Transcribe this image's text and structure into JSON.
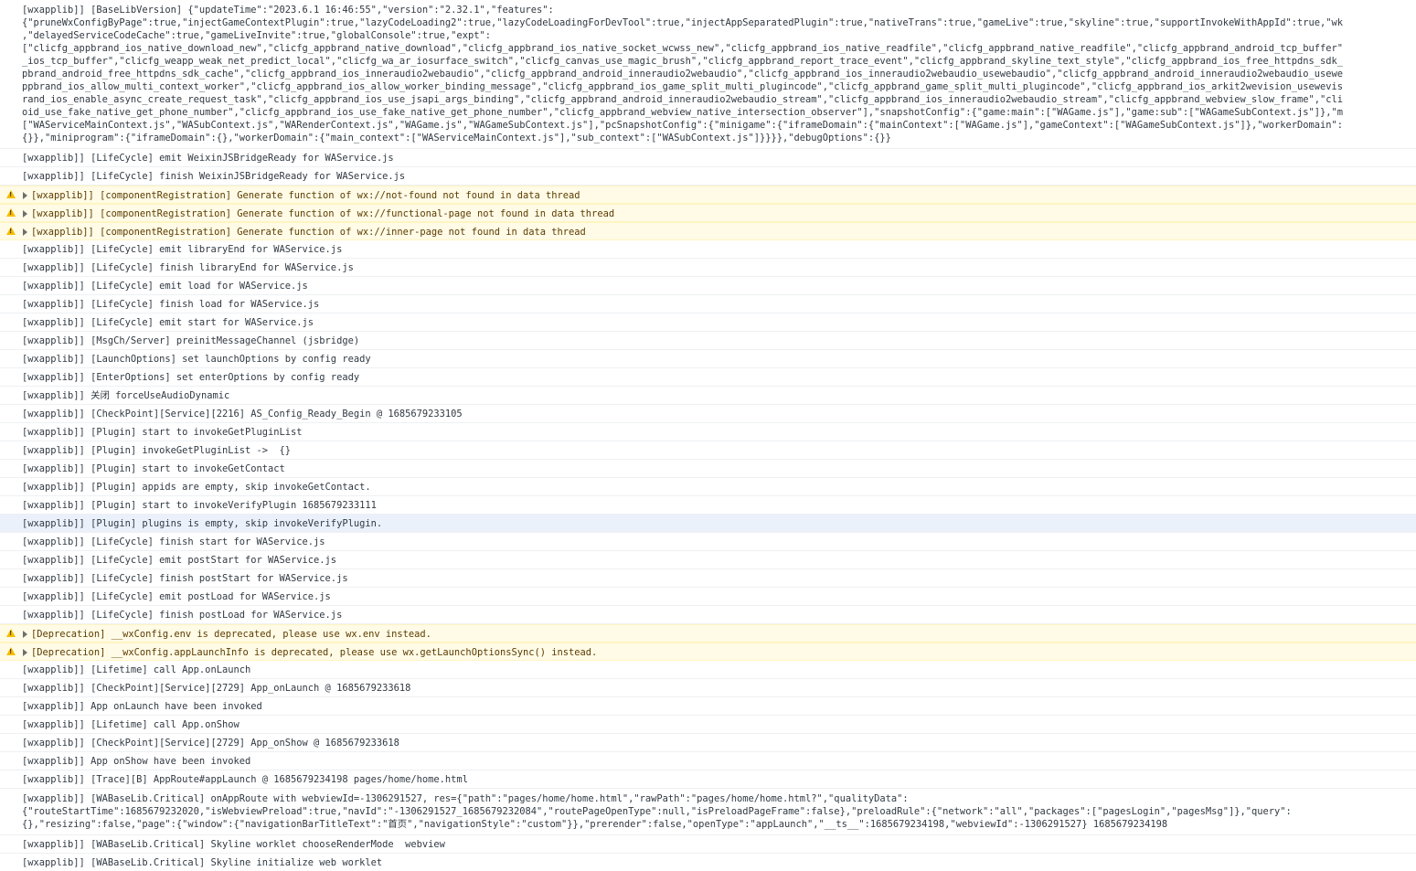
{
  "console": {
    "rows": [
      {
        "level": "log",
        "lines": [
          "[wxapplib]] [BaseLibVersion] {\"updateTime\":\"2023.6.1 16:46:55\",\"version\":\"2.32.1\",\"features\":",
          "{\"pruneWxConfigByPage\":true,\"injectGameContextPlugin\":true,\"lazyCodeLoading2\":true,\"lazyCodeLoadingForDevTool\":true,\"injectAppSeparatedPlugin\":true,\"nativeTrans\":true,\"gameLive\":true,\"skyline\":true,\"supportInvokeWithAppId\":true,\"wk",
          ",\"delayedServiceCodeCache\":true,\"gameLiveInvite\":true,\"globalConsole\":true,\"expt\":",
          "[\"clicfg_appbrand_ios_native_download_new\",\"clicfg_appbrand_native_download\",\"clicfg_appbrand_ios_native_socket_wcwss_new\",\"clicfg_appbrand_ios_native_readfile\",\"clicfg_appbrand_native_readfile\",\"clicfg_appbrand_android_tcp_buffer\"",
          "_ios_tcp_buffer\",\"clicfg_weapp_weak_net_predict_local\",\"clicfg_wa_ar_iosurface_switch\",\"clicfg_canvas_use_magic_brush\",\"clicfg_appbrand_report_trace_event\",\"clicfg_appbrand_skyline_text_style\",\"clicfg_appbrand_ios_free_httpdns_sdk_",
          "pbrand_android_free_httpdns_sdk_cache\",\"clicfg_appbrand_ios_inneraudio2webaudio\",\"clicfg_appbrand_android_inneraudio2webaudio\",\"clicfg_appbrand_ios_inneraudio2webaudio_usewebaudio\",\"clicfg_appbrand_android_inneraudio2webaudio_usewe",
          "ppbrand_ios_allow_multi_context_worker\",\"clicfg_appbrand_ios_allow_worker_binding_message\",\"clicfg_appbrand_ios_game_split_multi_plugincode\",\"clicfg_appbrand_game_split_multi_plugincode\",\"clicfg_appbrand_ios_arkit2wevision_usewevis",
          "rand_ios_enable_async_create_request_task\",\"clicfg_appbrand_ios_use_jsapi_args_binding\",\"clicfg_appbrand_android_inneraudio2webaudio_stream\",\"clicfg_appbrand_ios_inneraudio2webaudio_stream\",\"clicfg_appbrand_webview_slow_frame\",\"cli",
          "oid_use_fake_native_get_phone_number\",\"clicfg_appbrand_ios_use_fake_native_get_phone_number\",\"clicfg_appbrand_webview_native_intersection_observer\"],\"snapshotConfig\":{\"game:main\":[\"WAGame.js\"],\"game:sub\":[\"WAGameSubContext.js\"]},\"m",
          "[\"WAServiceMainContext.js\",\"WASubContext.js\",\"WARenderContext.js\",\"WAGame.js\",\"WAGameSubContext.js\"],\"pcSnapshotConfig\":{\"minigame\":{\"iframeDomain\":{\"mainContext\":[\"WAGame.js\"],\"gameContext\":[\"WAGameSubContext.js\"]},\"workerDomain\":",
          "{}},\"miniprogram\":{\"iframeDomain\":{},\"workerDomain\":{\"main_context\":[\"WAServiceMainContext.js\"],\"sub_context\":[\"WASubContext.js\"]}}}},\"debugOptions\":{}}"
        ]
      },
      {
        "level": "log",
        "text": "[wxapplib]] [LifeCycle] emit WeixinJSBridgeReady for WAService.js"
      },
      {
        "level": "log",
        "text": "[wxapplib]] [LifeCycle] finish WeixinJSBridgeReady for WAService.js"
      },
      {
        "level": "warn",
        "text": "[wxapplib]] [componentRegistration] Generate function of wx://not-found not found in data thread"
      },
      {
        "level": "warn",
        "text": "[wxapplib]] [componentRegistration] Generate function of wx://functional-page not found in data thread"
      },
      {
        "level": "warn",
        "text": "[wxapplib]] [componentRegistration] Generate function of wx://inner-page not found in data thread"
      },
      {
        "level": "log",
        "text": "[wxapplib]] [LifeCycle] emit libraryEnd for WAService.js"
      },
      {
        "level": "log",
        "text": "[wxapplib]] [LifeCycle] finish libraryEnd for WAService.js"
      },
      {
        "level": "log",
        "text": "[wxapplib]] [LifeCycle] emit load for WAService.js"
      },
      {
        "level": "log",
        "text": "[wxapplib]] [LifeCycle] finish load for WAService.js"
      },
      {
        "level": "log",
        "text": "[wxapplib]] [LifeCycle] emit start for WAService.js"
      },
      {
        "level": "log",
        "text": "[wxapplib]] [MsgCh/Server] preinitMessageChannel (jsbridge)"
      },
      {
        "level": "log",
        "text": "[wxapplib]] [LaunchOptions] set launchOptions by config ready"
      },
      {
        "level": "log",
        "text": "[wxapplib]] [EnterOptions] set enterOptions by config ready"
      },
      {
        "level": "log",
        "text": "[wxapplib]] 关闭 forceUseAudioDynamic"
      },
      {
        "level": "log",
        "text": "[wxapplib]] [CheckPoint][Service][2216] AS_Config_Ready_Begin @ 1685679233105"
      },
      {
        "level": "log",
        "text": "[wxapplib]] [Plugin] start to invokeGetPluginList"
      },
      {
        "level": "log",
        "text": "[wxapplib]] [Plugin] invokeGetPluginList ->  {}"
      },
      {
        "level": "log",
        "text": "[wxapplib]] [Plugin] start to invokeGetContact"
      },
      {
        "level": "log",
        "text": "[wxapplib]] [Plugin] appids are empty, skip invokeGetContact."
      },
      {
        "level": "log",
        "text": "[wxapplib]] [Plugin] start to invokeVerifyPlugin 1685679233111"
      },
      {
        "level": "log",
        "highlight": true,
        "text": "[wxapplib]] [Plugin] plugins is empty, skip invokeVerifyPlugin."
      },
      {
        "level": "log",
        "text": "[wxapplib]] [LifeCycle] finish start for WAService.js"
      },
      {
        "level": "log",
        "text": "[wxapplib]] [LifeCycle] emit postStart for WAService.js"
      },
      {
        "level": "log",
        "text": "[wxapplib]] [LifeCycle] finish postStart for WAService.js"
      },
      {
        "level": "log",
        "text": "[wxapplib]] [LifeCycle] emit postLoad for WAService.js"
      },
      {
        "level": "log",
        "text": "[wxapplib]] [LifeCycle] finish postLoad for WAService.js"
      },
      {
        "level": "warn",
        "text": "[Deprecation] __wxConfig.env is deprecated, please use wx.env instead."
      },
      {
        "level": "warn",
        "text": "[Deprecation] __wxConfig.appLaunchInfo is deprecated, please use wx.getLaunchOptionsSync() instead."
      },
      {
        "level": "log",
        "text": "[wxapplib]] [Lifetime] call App.onLaunch"
      },
      {
        "level": "log",
        "text": "[wxapplib]] [CheckPoint][Service][2729] App_onLaunch @ 1685679233618"
      },
      {
        "level": "log",
        "text": "[wxapplib]] App onLaunch have been invoked"
      },
      {
        "level": "log",
        "text": "[wxapplib]] [Lifetime] call App.onShow"
      },
      {
        "level": "log",
        "text": "[wxapplib]] [CheckPoint][Service][2729] App_onShow @ 1685679233618"
      },
      {
        "level": "log",
        "text": "[wxapplib]] App onShow have been invoked"
      },
      {
        "level": "log",
        "text": "[wxapplib]] [Trace][B] AppRoute#appLaunch @ 1685679234198 pages/home/home.html"
      },
      {
        "level": "log",
        "lines": [
          "[wxapplib]] [WABaseLib.Critical] onAppRoute with webviewId=-1306291527, res={\"path\":\"pages/home/home.html\",\"rawPath\":\"pages/home/home.html?\",\"qualityData\":",
          "{\"routeStartTime\":1685679232020,\"isWebviewPreload\":true,\"navId\":\"-1306291527_1685679232084\",\"routePageOpenType\":null,\"isPreloadPageFrame\":false},\"preloadRule\":{\"network\":\"all\",\"packages\":[\"pagesLogin\",\"pagesMsg\"]},\"query\":",
          "{},\"resizing\":false,\"page\":{\"window\":{\"navigationBarTitleText\":\"首页\",\"navigationStyle\":\"custom\"}},\"prerender\":false,\"openType\":\"appLaunch\",\"__ts__\":1685679234198,\"webviewId\":-1306291527} 1685679234198"
        ]
      },
      {
        "level": "log",
        "text": "[wxapplib]] [WABaseLib.Critical] Skyline worklet chooseRenderMode  webview"
      },
      {
        "level": "log",
        "text": "[wxapplib]] [WABaseLib.Critical] Skyline initialize web worklet"
      }
    ]
  }
}
